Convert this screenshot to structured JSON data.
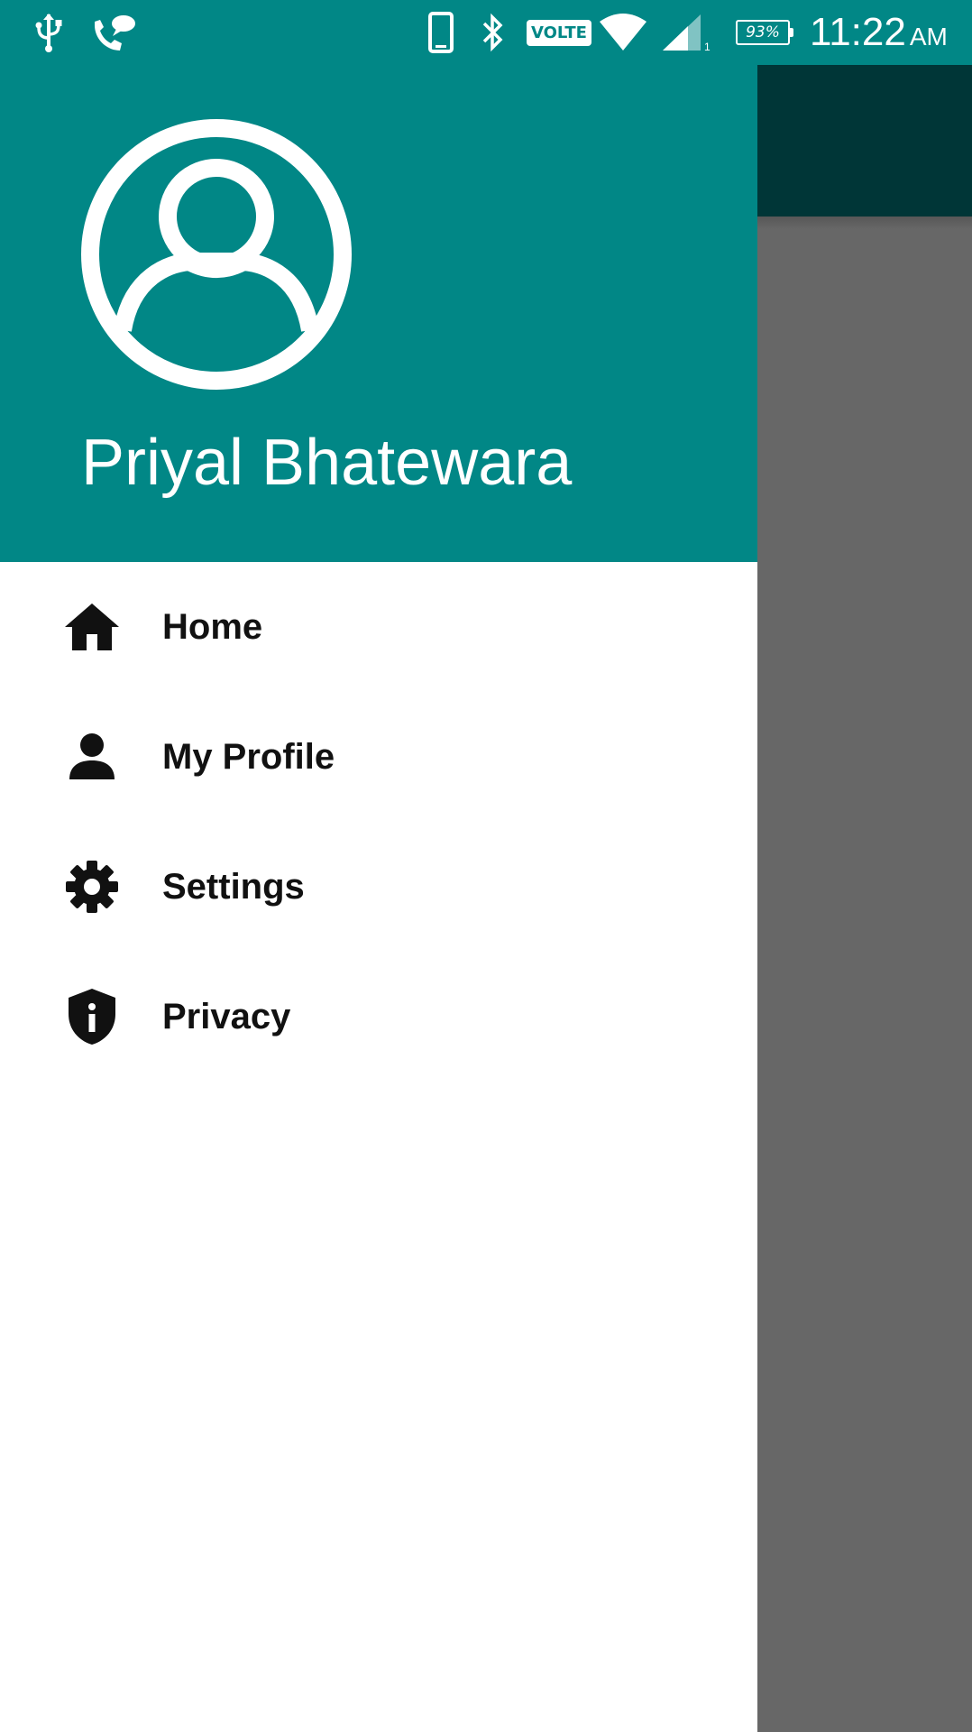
{
  "status_bar": {
    "icons": [
      "usb-icon",
      "wifi-calling-icon",
      "phone-device-icon",
      "bluetooth-icon",
      "volte-badge",
      "wifi-icon",
      "cell-signal-icon",
      "battery-icon"
    ],
    "volte_label": "VOLTE",
    "sim_slot": "1",
    "battery_level": "93%",
    "time": "11:22",
    "ampm": "AM"
  },
  "drawer": {
    "header": {
      "avatar_icon": "account-circle-icon",
      "user_name": "Priyal Bhatewara"
    },
    "menu": [
      {
        "label": "Home",
        "icon": "home-icon"
      },
      {
        "label": "My Profile",
        "icon": "person-icon"
      },
      {
        "label": "Settings",
        "icon": "gear-icon"
      },
      {
        "label": "Privacy",
        "icon": "shield-info-icon"
      }
    ]
  },
  "colors": {
    "primary": "#018786",
    "primary_dark": "#003637",
    "scrim": "#676767",
    "drawer_bg": "#ffffff",
    "menu_text": "#111111"
  }
}
